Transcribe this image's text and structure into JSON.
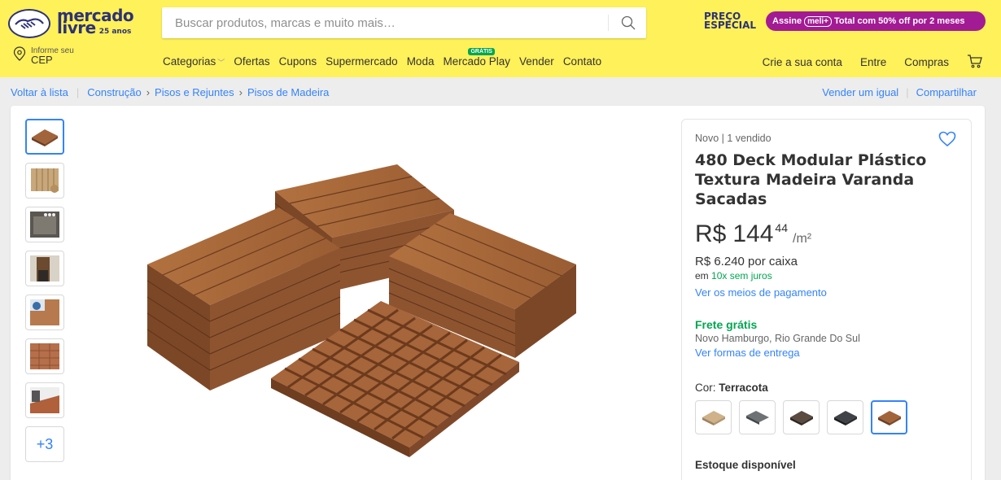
{
  "brand": {
    "logo_line1": "mercado",
    "logo_line2": "livre",
    "logo_anos": "25 anos"
  },
  "search": {
    "placeholder": "Buscar produtos, marcas e muito mais…"
  },
  "promo": {
    "line1": "PREÇO",
    "line2": "ESPECIAL",
    "pill_prefix": "Assine",
    "pill_badge": "meli+",
    "pill_text": "Total com 50% off por 2 meses"
  },
  "location": {
    "small": "Informe seu",
    "main": "CEP"
  },
  "nav": {
    "items": [
      "Categorias",
      "Ofertas",
      "Cupons",
      "Supermercado",
      "Moda",
      "Mercado Play",
      "Vender",
      "Contato"
    ],
    "badge_gratis": "GRÁTIS"
  },
  "account": {
    "create": "Crie a sua conta",
    "login": "Entre",
    "purchases": "Compras"
  },
  "breadcrumb": {
    "back": "Voltar à lista",
    "path": [
      "Construção",
      "Pisos e Rejuntes",
      "Pisos de Madeira"
    ],
    "sell_same": "Vender um igual",
    "share": "Compartilhar"
  },
  "thumbnails": {
    "more": "+3"
  },
  "product": {
    "condition": "Novo  |  1 vendido",
    "title": "480 Deck Modular Plástico Textura Madeira Varanda Sacadas",
    "currency": "R$",
    "price_int": "144",
    "price_cents": "44",
    "unit": "/m²",
    "box_price": "R$ 6.240 por caixa",
    "installments_prefix": "em",
    "installments_green": "10x sem juros",
    "payment_link": "Ver os meios de pagamento",
    "shipping": "Frete grátis",
    "origin": "Novo Hamburgo, Rio Grande Do Sul",
    "shipping_link": "Ver formas de entrega",
    "color_label": "Cor:",
    "color_value": "Terracota",
    "stock": "Estoque disponível"
  },
  "colors": {
    "brand_yellow": "#fff159",
    "brand_blue": "#2d3277",
    "link_blue": "#3483fa",
    "success_green": "#00a650",
    "promo_purple": "#a31b94",
    "wood": "#a2643b"
  }
}
